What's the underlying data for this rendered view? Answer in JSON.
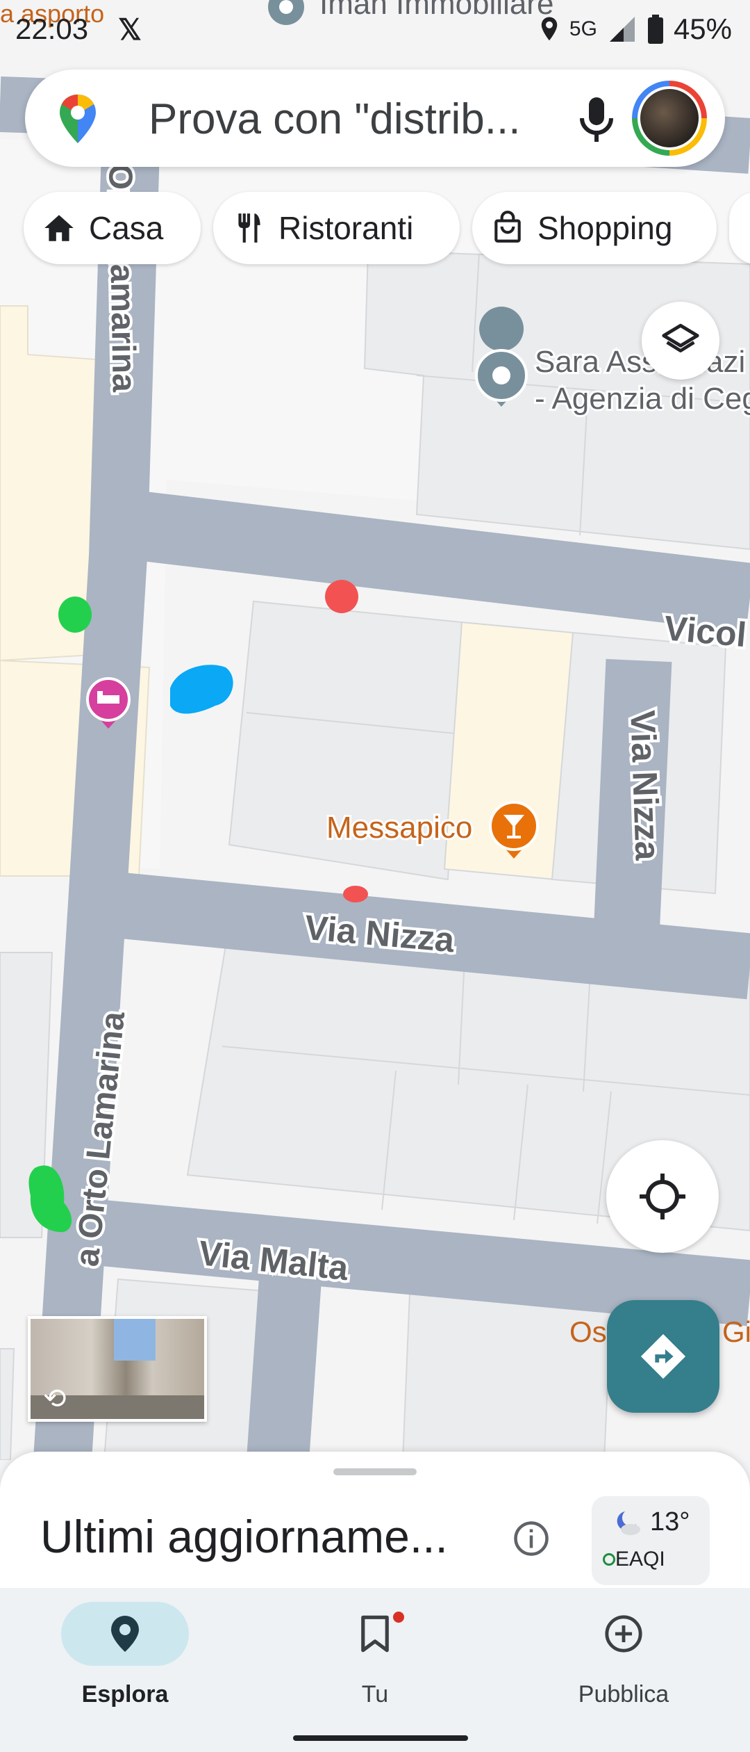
{
  "status_bar": {
    "time": "22:03",
    "app_icon": "x-logo-icon",
    "network": "5G",
    "battery": "45%"
  },
  "search": {
    "placeholder": "Prova con \"distrib..."
  },
  "chips": [
    {
      "label": "Casa",
      "icon": "home-icon"
    },
    {
      "label": "Ristoranti",
      "icon": "fork-knife-icon"
    },
    {
      "label": "Shopping",
      "icon": "shopping-bag-icon"
    }
  ],
  "map": {
    "streets": {
      "orto_lamarina_1": "Orto Lamarina",
      "orto_lamarina_2": "a Orto Lamarina",
      "via_nizza_h": "Via Nizza",
      "via_nizza_v": "Via Nizza",
      "via_malta": "Via Malta",
      "vicol": "Vicol"
    },
    "places": {
      "asporto": "a asporto",
      "iman": "Iman Immobiliare",
      "sara_line1": "Sara Assicurazi",
      "sara_line2": "- Agenzia di Ceg",
      "messapico": "Messapico",
      "os": "Os",
      "gi": "Gi"
    },
    "colors": {
      "road": "#aab4c3",
      "block": "#ebecee",
      "building_yellow": "#fdf6e3",
      "poi_orange": "#e8710a",
      "poi_pink": "#e040a0",
      "marker_red": "#f25252",
      "marker_green": "#23d04d",
      "marker_blue": "#0aa8f5"
    }
  },
  "sheet": {
    "title": "Ultimi aggiorname..."
  },
  "weather": {
    "temp": "13°",
    "aqi": "EAQI"
  },
  "nav": {
    "explore": "Esplora",
    "you": "Tu",
    "contribute": "Pubblica"
  }
}
